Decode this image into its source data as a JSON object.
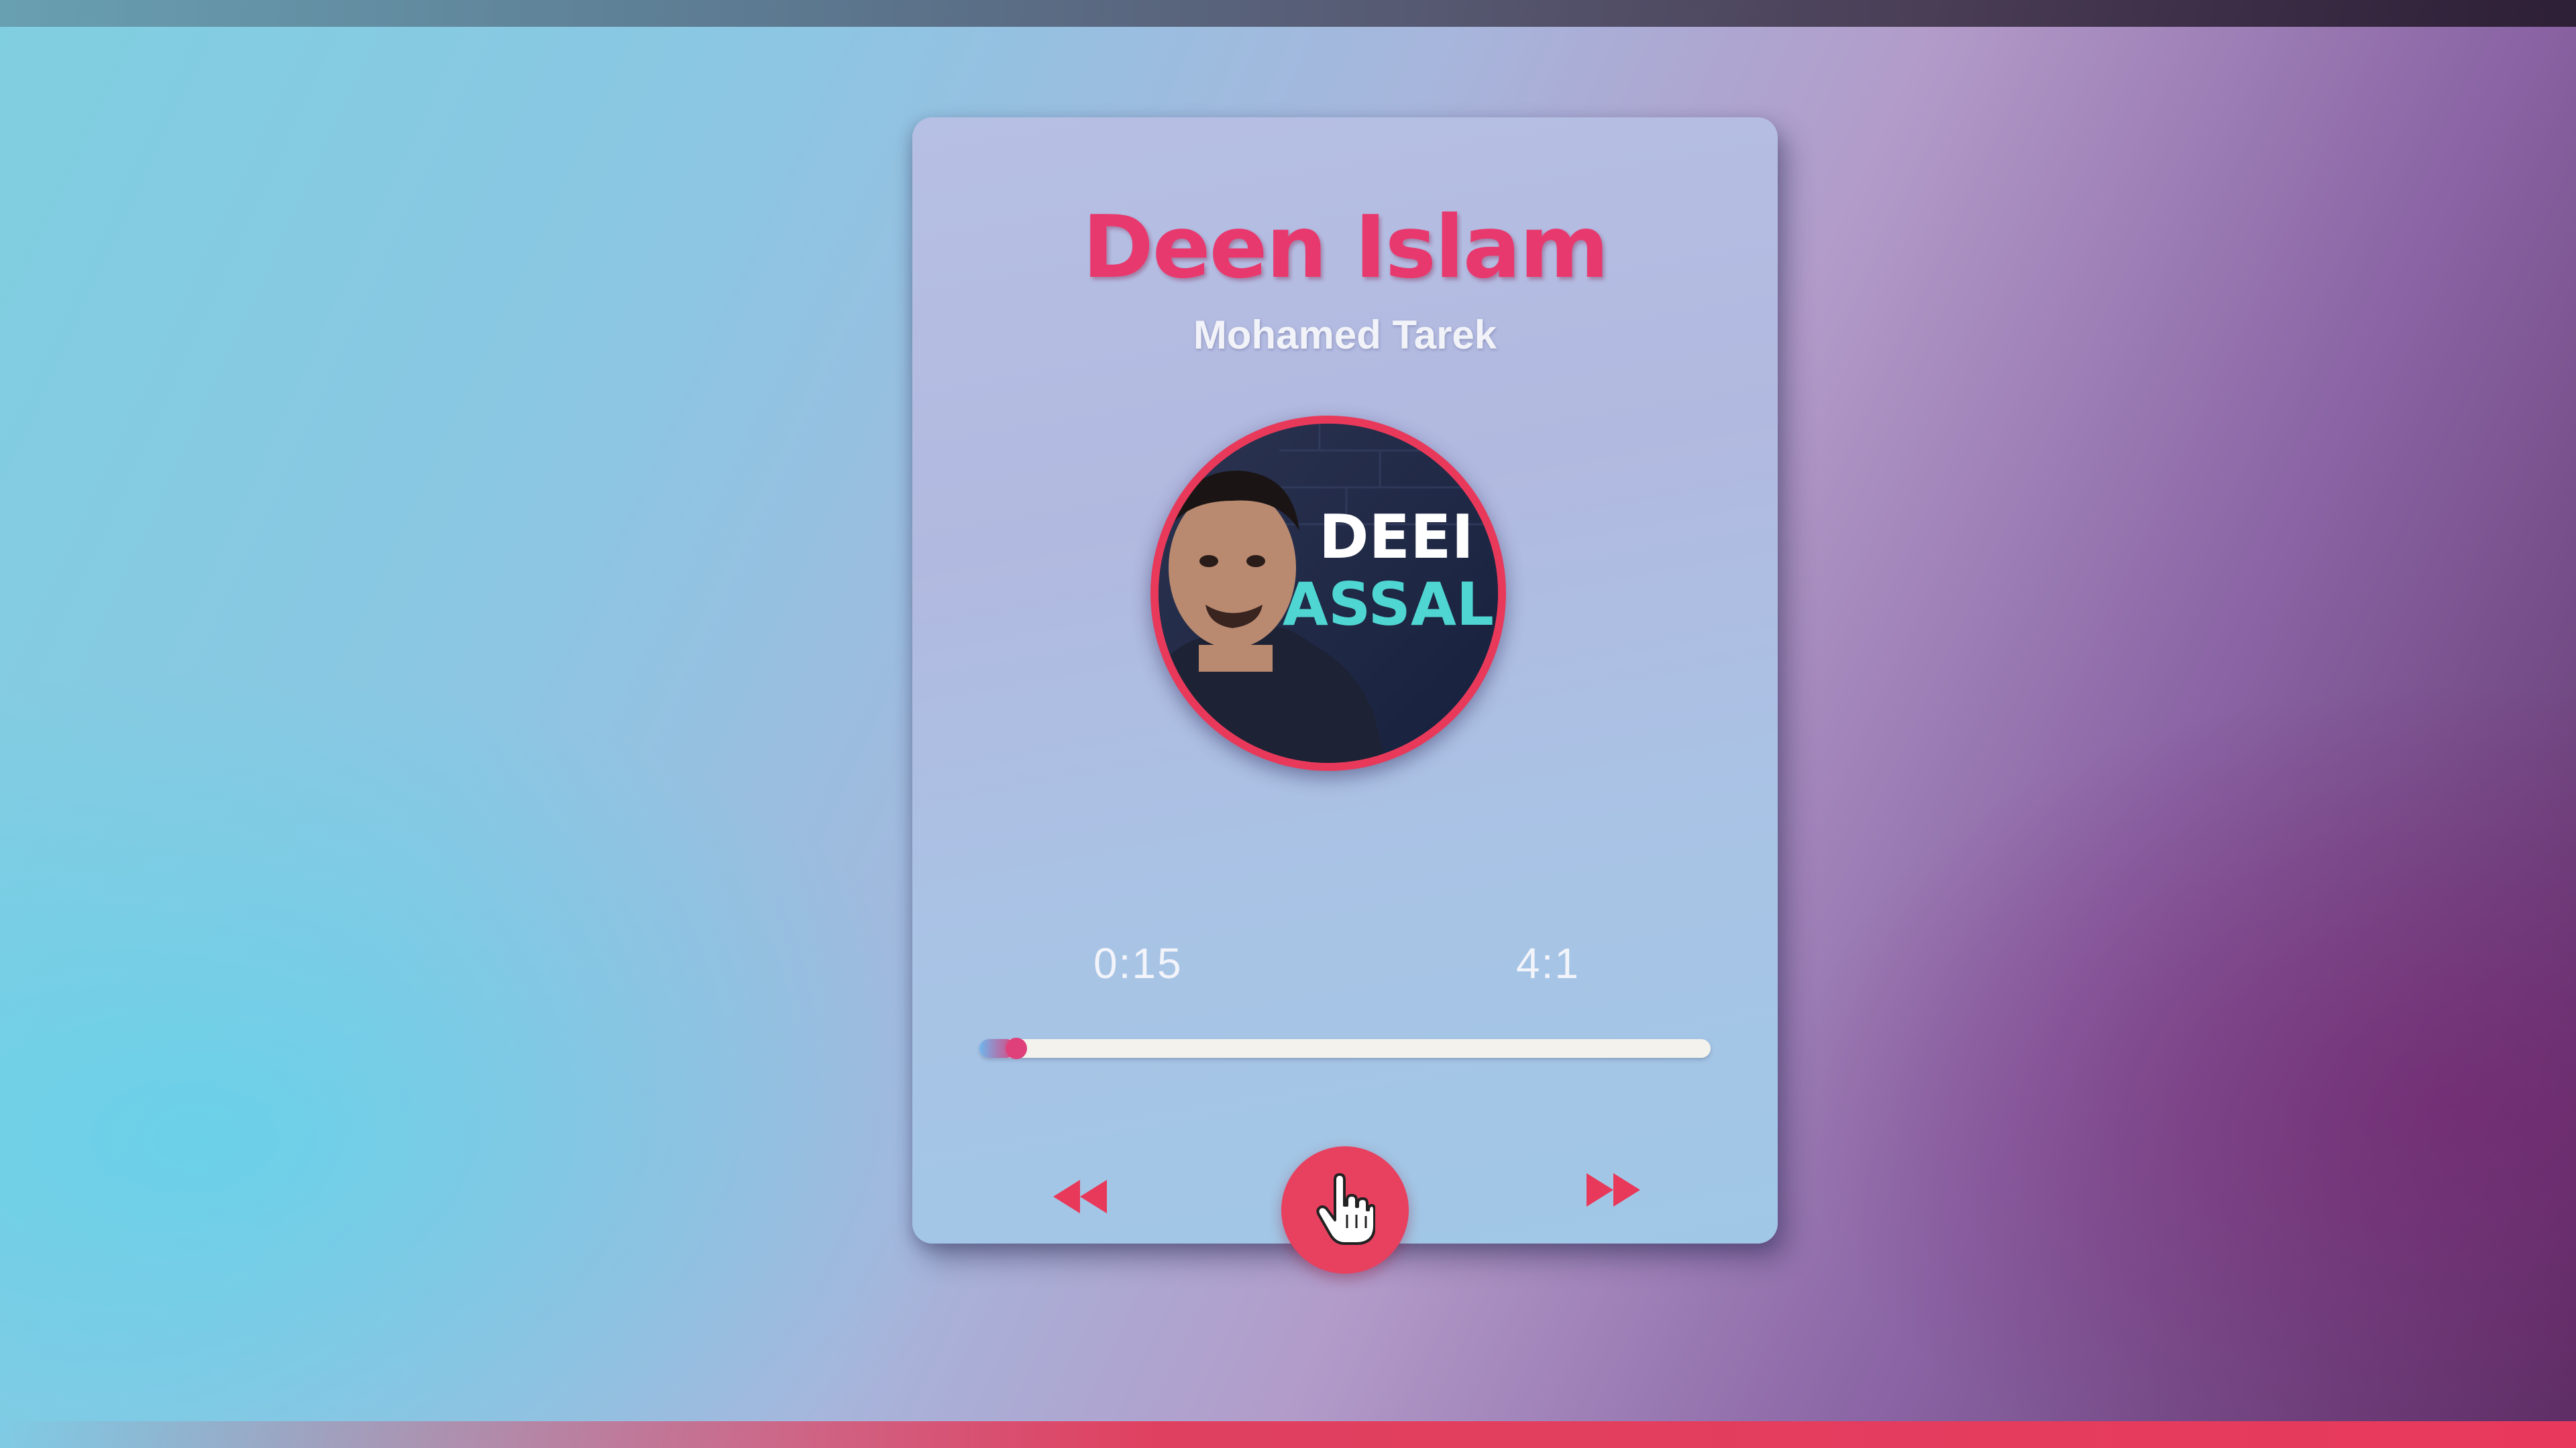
{
  "player": {
    "title": "Deen Islam",
    "artist": "Mohamed Tarek",
    "album_art": {
      "caption_line1": "DEEI",
      "caption_line2": "ASSAL"
    },
    "time_current": "0:15",
    "time_total": "4:1",
    "progress_fraction": 0.05
  },
  "controls": {
    "rewind_icon": "rewind-icon",
    "play_icon": "hand-pointer-icon",
    "forward_icon": "fast-forward-icon"
  },
  "colors": {
    "accent": "#e8396e",
    "progress_track": "#f3f2ec"
  }
}
